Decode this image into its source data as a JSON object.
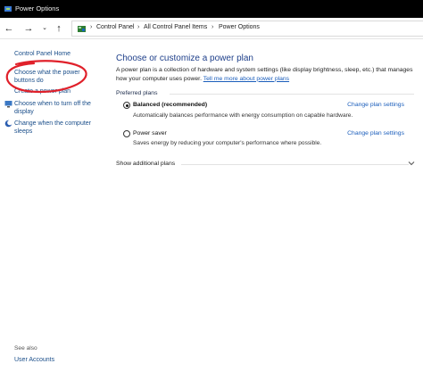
{
  "window": {
    "title": "Power Options",
    "app_icon": "power-options-icon"
  },
  "nav": {
    "back_icon": "back-arrow-icon",
    "forward_icon": "forward-arrow-icon",
    "dropdown_icon": "chevron-down-icon",
    "up_icon": "up-arrow-icon",
    "breadcrumbs": [
      "Control Panel",
      "All Control Panel Items",
      "Power Options"
    ]
  },
  "sidebar": {
    "home": "Control Panel Home",
    "links": [
      {
        "line1": "Choose what the power",
        "line2": "buttons do"
      },
      {
        "line1": "Create a power plan",
        "line2": ""
      },
      {
        "line1": "Choose when to turn off the",
        "line2": "display"
      },
      {
        "line1": "Change when the computer",
        "line2": "sleeps"
      }
    ],
    "see_also": "See also",
    "user_accounts": "User Accounts"
  },
  "main": {
    "title": "Choose or customize a power plan",
    "description": "A power plan is a collection of hardware and system settings (like display brightness, sleep, etc.) that manages how your computer uses power.",
    "learn_more": "Tell me more about power plans",
    "preferred_label": "Preferred plans",
    "plans": [
      {
        "name": "Balanced (recommended)",
        "desc": "Automatically balances performance with energy consumption on capable hardware.",
        "link": "Change plan settings",
        "selected": true
      },
      {
        "name": "Power saver",
        "desc": "Saves energy by reducing your computer's performance where possible.",
        "link": "Change plan settings",
        "selected": false
      }
    ],
    "show_additional": "Show additional plans"
  },
  "colors": {
    "link": "#1a5dbb",
    "annotation": "#e0202a",
    "title": "#1e3f8a"
  }
}
